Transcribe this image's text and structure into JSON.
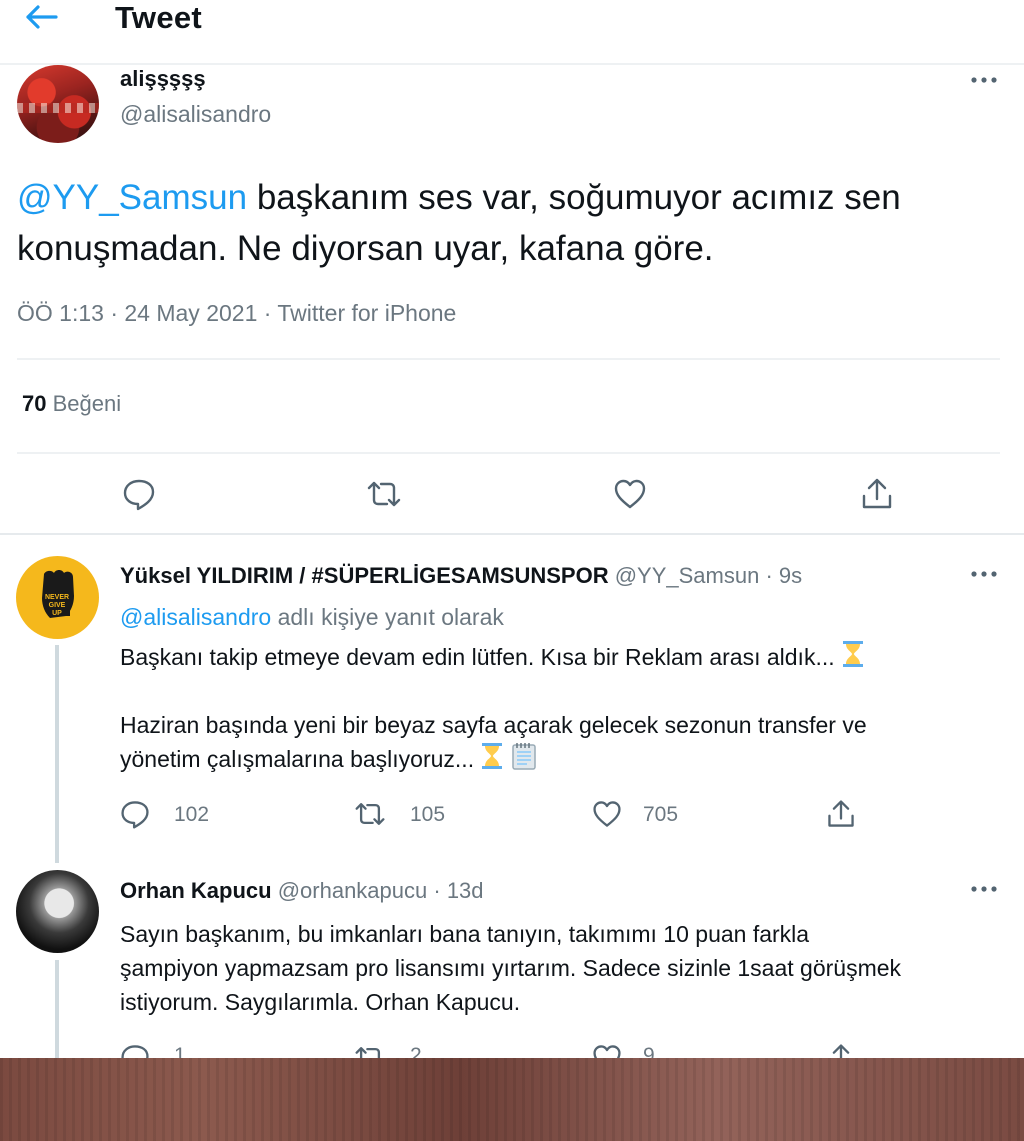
{
  "header": {
    "title": "Tweet"
  },
  "main_tweet": {
    "display_name": "alişşşşş",
    "handle": "@alisalisandro",
    "mention": "@YY_Samsun",
    "text_line1_rest": " başkanım ses var, soğumuyor acımız sen",
    "text_line2": "konuşmadan. Ne diyorsan uyar, kafana göre.",
    "meta": "ÖÖ 1:13 · 24 May 2021 · Twitter for iPhone",
    "likes_count": "70",
    "likes_label": "Beğeni"
  },
  "replies": [
    {
      "display_name": "Yüksel YILDIRIM / #SÜPERLİGESAMSUNSPOR",
      "handle": "@YY_Samsun",
      "time": "· 9s",
      "reply_to_handle": "@alisalisandro",
      "reply_to_suffix": " adlı kişiye yanıt olarak",
      "line1": "Başkanı takip etmeye devam edin lütfen. Kısa bir Reklam arası aldık...",
      "line2": "Haziran başında yeni bir beyaz sayfa açarak gelecek sezonun transfer ve",
      "line3": "yönetim çalışmalarına başlıyoruz...",
      "avatar_text": "NEVER GIVE UP",
      "replies": "102",
      "retweets": "105",
      "likes": "705"
    },
    {
      "display_name": "Orhan Kapucu",
      "handle": "@orhankapucu",
      "time": "· 13d",
      "line1": "Sayın başkanım, bu imkanları bana tanıyın, takımımı 10 puan farkla",
      "line2": "şampiyon yapmazsam pro lisansımı yırtarım. Sadece sizinle 1saat görüşmek",
      "line3": "istiyorum. Saygılarımla. Orhan Kapucu.",
      "replies": "1",
      "retweets": "2",
      "likes": "9"
    }
  ],
  "icons": {
    "accent": "#1d9bf0",
    "grey": "#536471"
  }
}
